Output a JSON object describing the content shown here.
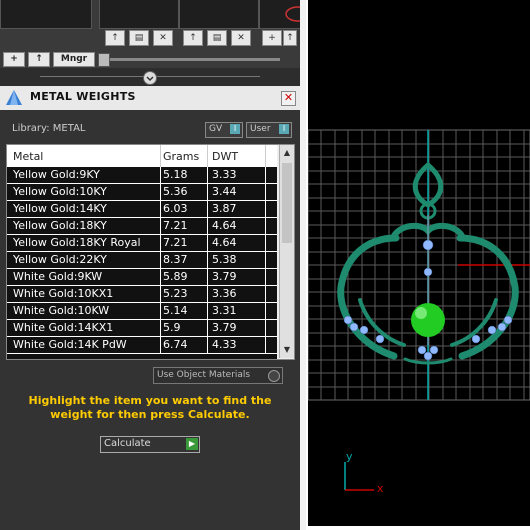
{
  "panel": {
    "title": "METAL WEIGHTS",
    "close_glyph": "✕",
    "library_label": "Library: METAL",
    "toggle_gv": "GV",
    "toggle_user": "User",
    "toggle_check": "I"
  },
  "nav": {
    "mngr": "Mngr",
    "add": "+",
    "up": "↑"
  },
  "table": {
    "columns": [
      "Metal",
      "Grams",
      "DWT"
    ],
    "rows": [
      [
        "Yellow Gold:9KY",
        "5.18",
        "3.33"
      ],
      [
        "Yellow Gold:10KY",
        "5.36",
        "3.44"
      ],
      [
        "Yellow Gold:14KY",
        "6.03",
        "3.87"
      ],
      [
        "Yellow Gold:18KY",
        "7.21",
        "4.64"
      ],
      [
        "Yellow Gold:18KY Royal",
        "7.21",
        "4.64"
      ],
      [
        "Yellow Gold:22KY",
        "8.37",
        "5.38"
      ],
      [
        "White Gold:9KW",
        "5.89",
        "3.79"
      ],
      [
        "White Gold:10KX1",
        "5.23",
        "3.36"
      ],
      [
        "White Gold:10KW",
        "5.14",
        "3.31"
      ],
      [
        "White Gold:14KX1",
        "5.9",
        "3.79"
      ],
      [
        "White Gold:14K PdW",
        "6.74",
        "4.33"
      ]
    ]
  },
  "use_object_materials": "Use Object Materials",
  "hint": "Highlight the item you want to find the weight for then press Calculate.",
  "calculate_label": "Calculate",
  "viewport": {
    "axis_y": "y",
    "axis_x": "x"
  },
  "colors": {
    "hint": "#ffcc00",
    "metal": "#1e8a6e",
    "gem": "#8fb8ff",
    "ball": "#22cc22",
    "axis_y": "#00aaaa",
    "axis_x": "#cc0000"
  }
}
